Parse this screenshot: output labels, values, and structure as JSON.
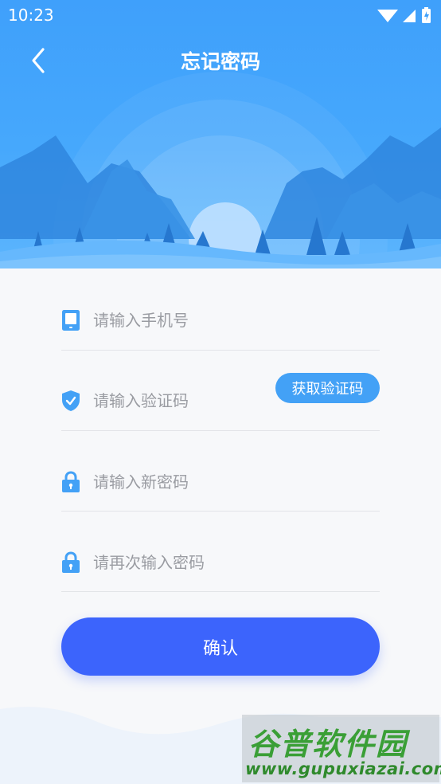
{
  "status_bar": {
    "time": "10:23"
  },
  "header": {
    "title": "忘记密码"
  },
  "form": {
    "phone_placeholder": "请输入手机号",
    "code_placeholder": "请输入验证码",
    "get_code_label": "获取验证码",
    "new_password_placeholder": "请输入新密码",
    "confirm_password_placeholder": "请再次输入密码",
    "submit_label": "确认"
  },
  "watermark": {
    "brand": "谷普软件园",
    "url": "www.gupuxiazai.com"
  },
  "colors": {
    "header_blue": "#3fa0fb",
    "accent": "#43a1f6",
    "submit": "#3c64fc"
  },
  "icons": {
    "back": "chevron-left-icon",
    "phone": "tablet-icon",
    "code": "shield-check-icon",
    "password": "lock-icon"
  }
}
